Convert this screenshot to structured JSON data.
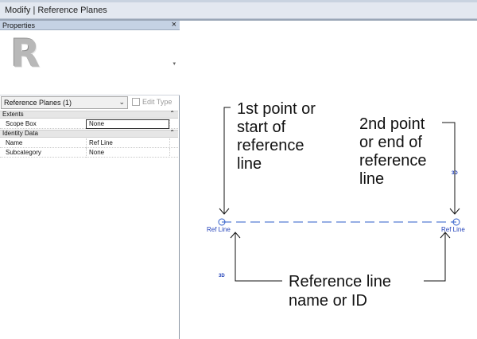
{
  "context_bar": {
    "title": "Modify | Reference Planes"
  },
  "properties": {
    "title": "Properties",
    "close_glyph": "×",
    "type_selector": {
      "value": "Reference Planes (1)",
      "edit_type_label": "Edit Type"
    },
    "sections": [
      {
        "name": "Extents",
        "collapse_glyph": "⌃",
        "rows": [
          {
            "key": "Scope Box",
            "value": "None"
          }
        ]
      },
      {
        "name": "Identity Data",
        "collapse_glyph": "⌃",
        "rows": [
          {
            "key": "Name",
            "value": "Ref Line"
          },
          {
            "key": "Subcategory",
            "value": "None"
          }
        ]
      }
    ]
  },
  "canvas": {
    "left_end_label": "Ref Line",
    "right_end_label": "Ref Line",
    "tag_3d_top": "3D",
    "tag_3d_bottom": "3D",
    "annotation_left": [
      "1st point or",
      "start of",
      "reference",
      "line"
    ],
    "annotation_right": [
      "2nd point",
      "or end of",
      "reference",
      "line"
    ],
    "annotation_bottom": [
      "Reference  line",
      "name or ID"
    ]
  },
  "icons": {
    "revit_logo": "R",
    "dropdown_caret": "⌄",
    "preview_caret": "▾"
  },
  "colors": {
    "ref_line": "#2e5cc9",
    "label_blue": "#1f3fb8",
    "panel_header": "#c5d2e4"
  }
}
